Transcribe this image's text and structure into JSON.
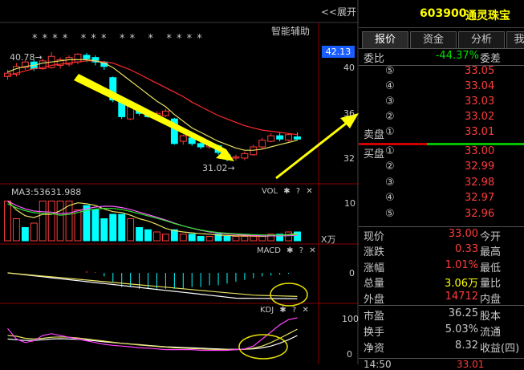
{
  "chart": {
    "expand_label": "<<展开",
    "stars": "* * * *   * * *   * *   *   * * * *",
    "assist_label": "智能辅助",
    "high_price_label": "40.78",
    "low_price_label": "31.02",
    "price_ticks": [
      "40",
      "36",
      "32"
    ],
    "current_price_tag": "42.13",
    "vol": {
      "ma_label": "MA3:53631.988",
      "name": "VOL",
      "tick": "10",
      "unit": "X万"
    },
    "macd": {
      "name": "MACD",
      "tick": "0"
    },
    "kdj": {
      "name": "KDJ",
      "ticks": [
        "100",
        "0"
      ]
    },
    "question": "?",
    "close": "✕",
    "gear": "✱",
    "bottom_cut_left": "14:50"
  },
  "chart_data": {
    "type": "candlestick",
    "ylim": [
      29.5,
      42
    ],
    "candles": [
      {
        "o": 38.6,
        "c": 38.9,
        "h": 39.2,
        "l": 38.3
      },
      {
        "o": 38.8,
        "c": 39.5,
        "h": 39.8,
        "l": 38.6
      },
      {
        "o": 39.4,
        "c": 39.9,
        "h": 40.1,
        "l": 39.2
      },
      {
        "o": 39.9,
        "c": 39.3,
        "h": 40.1,
        "l": 39.1
      },
      {
        "o": 39.3,
        "c": 40.0,
        "h": 40.2,
        "l": 39.2
      },
      {
        "o": 39.4,
        "c": 40.4,
        "h": 40.78,
        "l": 39.3
      },
      {
        "o": 39.6,
        "c": 40.1,
        "h": 40.3,
        "l": 39.3
      },
      {
        "o": 39.7,
        "c": 40.3,
        "h": 40.5,
        "l": 39.5
      },
      {
        "o": 39.9,
        "c": 40.6,
        "h": 40.7,
        "l": 39.7
      },
      {
        "o": 40.5,
        "c": 40.2,
        "h": 40.7,
        "l": 39.9
      },
      {
        "o": 40.3,
        "c": 39.9,
        "h": 40.5,
        "l": 39.6
      },
      {
        "o": 39.9,
        "c": 39.5,
        "h": 40.0,
        "l": 39.2
      },
      {
        "o": 38.5,
        "c": 36.5,
        "h": 38.6,
        "l": 36.3
      },
      {
        "o": 36.5,
        "c": 35.0,
        "h": 36.6,
        "l": 34.8
      },
      {
        "o": 34.8,
        "c": 35.9,
        "h": 36.1,
        "l": 34.7
      },
      {
        "o": 35.6,
        "c": 35.3,
        "h": 35.8,
        "l": 35.1
      },
      {
        "o": 35.3,
        "c": 35.0,
        "h": 35.5,
        "l": 34.9
      },
      {
        "o": 34.9,
        "c": 35.3,
        "h": 35.5,
        "l": 34.7
      },
      {
        "o": 35.1,
        "c": 35.5,
        "h": 35.7,
        "l": 35.0
      },
      {
        "o": 34.8,
        "c": 32.6,
        "h": 34.9,
        "l": 32.5
      },
      {
        "o": 32.8,
        "c": 33.3,
        "h": 33.4,
        "l": 32.5
      },
      {
        "o": 33.1,
        "c": 32.6,
        "h": 33.3,
        "l": 32.4
      },
      {
        "o": 32.6,
        "c": 32.3,
        "h": 32.9,
        "l": 32.1
      },
      {
        "o": 32.3,
        "c": 32.5,
        "h": 32.6,
        "l": 32.1
      },
      {
        "o": 32.4,
        "c": 31.8,
        "h": 32.5,
        "l": 31.6
      },
      {
        "o": 31.6,
        "c": 31.3,
        "h": 31.7,
        "l": 31.02
      },
      {
        "o": 31.3,
        "c": 31.4,
        "h": 31.6,
        "l": 31.1
      },
      {
        "o": 31.3,
        "c": 31.7,
        "h": 31.9,
        "l": 31.1
      },
      {
        "o": 31.6,
        "c": 32.3,
        "h": 32.5,
        "l": 31.5
      },
      {
        "o": 32.3,
        "c": 32.9,
        "h": 33.1,
        "l": 32.1
      },
      {
        "o": 32.8,
        "c": 33.3,
        "h": 33.5,
        "l": 32.7
      },
      {
        "o": 33.3,
        "c": 33.0,
        "h": 33.6,
        "l": 32.8
      },
      {
        "o": 32.9,
        "c": 33.4,
        "h": 33.5,
        "l": 32.8
      },
      {
        "o": 33.2,
        "c": 33.0,
        "h": 33.6,
        "l": 32.9
      }
    ],
    "ma_short": [
      39.0,
      39.3,
      39.5,
      39.6,
      39.8,
      39.9,
      40.0,
      40.1,
      40.1,
      40.1,
      40.0,
      39.8,
      39.4,
      38.8,
      38.2,
      37.6,
      37.0,
      36.4,
      35.9,
      35.2,
      34.6,
      34.0,
      33.6,
      33.2,
      32.8,
      32.5,
      32.2,
      32.0,
      32.0,
      32.1,
      32.3,
      32.5,
      32.7,
      32.9
    ],
    "ma_long": [
      38.7,
      38.9,
      39.1,
      39.3,
      39.4,
      39.6,
      39.7,
      39.8,
      39.9,
      40.0,
      40.0,
      39.9,
      39.8,
      39.5,
      39.2,
      38.8,
      38.4,
      38.0,
      37.6,
      37.2,
      36.8,
      36.3,
      35.9,
      35.5,
      35.1,
      34.8,
      34.5,
      34.2,
      34.0,
      33.8,
      33.7,
      33.6,
      33.5,
      33.4
    ],
    "volume": [
      9,
      5,
      3,
      4,
      9,
      9,
      9,
      9,
      7,
      8,
      7,
      5,
      6,
      6,
      5,
      3,
      2.5,
      2,
      1.5,
      2.5,
      1.5,
      1.5,
      1,
      1,
      1.5,
      1,
      1,
      1,
      1,
      1,
      1.5,
      1.5,
      2,
      2
    ],
    "volume_red": [
      true,
      true,
      false,
      true,
      true,
      true,
      true,
      true,
      true,
      false,
      false,
      false,
      false,
      false,
      true,
      false,
      false,
      true,
      true,
      false,
      true,
      false,
      false,
      true,
      false,
      false,
      true,
      true,
      true,
      true,
      true,
      false,
      true,
      false
    ],
    "macd_bars": [
      0,
      0,
      0,
      0,
      0,
      0,
      0,
      0,
      0,
      0.1,
      0.05,
      -0.2,
      -0.5,
      -0.8,
      -0.8,
      -0.9,
      -0.9,
      -0.9,
      -0.9,
      -0.9,
      -0.9,
      -0.8,
      -0.8,
      -0.7,
      -0.7,
      -0.6,
      -0.5,
      -0.4,
      -0.3,
      -0.2,
      -0.15,
      -0.1,
      -0.05,
      0
    ],
    "kdj_k": [
      70,
      40,
      30,
      35,
      50,
      55,
      50,
      45,
      40,
      35,
      30,
      25,
      22,
      20,
      18,
      15,
      14,
      12,
      10,
      10,
      10,
      10,
      8,
      8,
      8,
      8,
      10,
      12,
      20,
      40,
      60,
      80,
      95,
      100
    ],
    "kdj_d": [
      50,
      48,
      42,
      40,
      42,
      45,
      46,
      45,
      43,
      40,
      37,
      34,
      31,
      28,
      26,
      23,
      21,
      19,
      17,
      15,
      14,
      13,
      12,
      11,
      10,
      10,
      10,
      11,
      14,
      20,
      30,
      42,
      55,
      68
    ],
    "kdj_j": [
      40,
      38,
      36,
      36,
      38,
      40,
      41,
      40,
      39,
      37,
      35,
      32,
      30,
      28,
      26,
      24,
      22,
      20,
      18,
      17,
      16,
      15,
      14,
      13,
      12,
      11,
      11,
      11,
      12,
      15,
      20,
      28,
      38,
      50
    ]
  },
  "quote": {
    "code": "603900",
    "name": "通灵珠宝",
    "tabs": [
      "报价",
      "资金",
      "分析",
      "我"
    ],
    "ratio_label": "委比",
    "ratio_value": "-44.37%",
    "ratio_right": "委差",
    "sell": [
      {
        "idx": "⑤",
        "price": "33.05"
      },
      {
        "idx": "④",
        "price": "33.04"
      },
      {
        "idx": "③",
        "price": "33.03"
      },
      {
        "idx": "②",
        "price": "33.02"
      },
      {
        "idx": "①",
        "price": "33.01",
        "label": "卖盘"
      }
    ],
    "buy": [
      {
        "idx": "①",
        "price": "33.00",
        "label": "买盘"
      },
      {
        "idx": "②",
        "price": "32.99"
      },
      {
        "idx": "③",
        "price": "32.98"
      },
      {
        "idx": "④",
        "price": "32.97"
      },
      {
        "idx": "⑤",
        "price": "32.96"
      }
    ],
    "stats1": [
      {
        "label": "现价",
        "value": "33.00",
        "right": "今开",
        "color": "red"
      },
      {
        "label": "涨跌",
        "value": "0.33",
        "right": "最高",
        "color": "red"
      },
      {
        "label": "涨幅",
        "value": "1.01%",
        "right": "最低",
        "color": "red"
      },
      {
        "label": "总量",
        "value": "3.06万",
        "right": "量比",
        "color": "yellow"
      },
      {
        "label": "外盘",
        "value": "14712",
        "right": "内盘",
        "color": "red"
      }
    ],
    "stats2": [
      {
        "label": "市盈",
        "value": "36.25",
        "right": "股本"
      },
      {
        "label": "换手",
        "value": "5.03%",
        "right": "流通"
      },
      {
        "label": "净资",
        "value": "8.32",
        "right": "收益(四)"
      }
    ],
    "bottom_cut_value": "33.01"
  }
}
